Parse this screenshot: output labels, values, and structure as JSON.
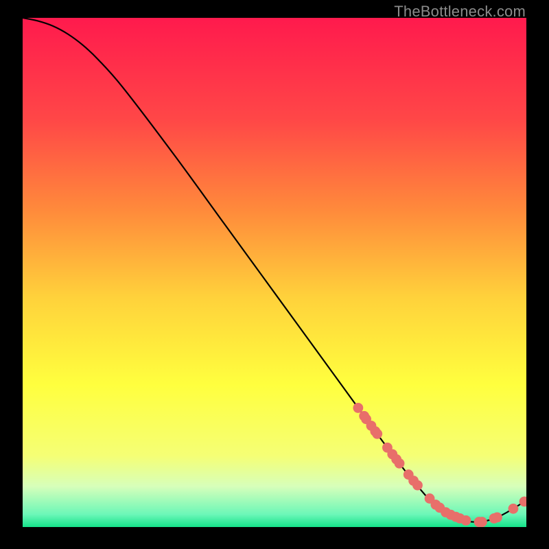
{
  "attribution": "TheBottleneck.com",
  "colors": {
    "black": "#000000",
    "curve": "#000000",
    "marker_fill": "#e86f6a",
    "marker_stroke": "#c64c47"
  },
  "chart_data": {
    "type": "line",
    "title": "",
    "xlabel": "",
    "ylabel": "",
    "xlim": [
      0,
      100
    ],
    "ylim": [
      0,
      100
    ],
    "grid": false,
    "legend": false,
    "background_gradient": {
      "stops": [
        {
          "pos": 0.0,
          "color": "#ff1a4d"
        },
        {
          "pos": 0.2,
          "color": "#ff4747"
        },
        {
          "pos": 0.38,
          "color": "#ff8b3b"
        },
        {
          "pos": 0.55,
          "color": "#ffd23b"
        },
        {
          "pos": 0.72,
          "color": "#ffff3e"
        },
        {
          "pos": 0.86,
          "color": "#f5ff75"
        },
        {
          "pos": 0.92,
          "color": "#d7ffba"
        },
        {
          "pos": 0.975,
          "color": "#6cf7b8"
        },
        {
          "pos": 1.0,
          "color": "#15e38a"
        }
      ]
    },
    "series": [
      {
        "name": "bottleneck-curve",
        "x": [
          0,
          3,
          6,
          9,
          12,
          15,
          20,
          30,
          40,
          50,
          60,
          70,
          75,
          80,
          82,
          85,
          88,
          90,
          92,
          94,
          96,
          98,
          100
        ],
        "y": [
          100,
          99.4,
          98.4,
          96.8,
          94.6,
          91.8,
          86.2,
          73.2,
          59.6,
          46.0,
          32.4,
          18.8,
          12.2,
          6.2,
          4.4,
          2.4,
          1.2,
          1.0,
          1.2,
          1.8,
          2.8,
          4.0,
          5.2
        ]
      }
    ],
    "markers": {
      "name": "highlighted-points",
      "x": [
        66.6,
        67.8,
        68.2,
        69.2,
        70.0,
        70.4,
        72.4,
        73.4,
        74.2,
        74.8,
        76.6,
        77.6,
        78.4,
        80.8,
        82.0,
        82.8,
        84.0,
        85.0,
        86.0,
        86.8,
        88.0,
        90.6,
        91.2,
        93.6,
        94.2,
        97.4,
        99.6
      ],
      "y": [
        23.4,
        21.8,
        21.2,
        19.9,
        18.8,
        18.3,
        15.6,
        14.3,
        13.3,
        12.5,
        10.3,
        9.1,
        8.2,
        5.6,
        4.4,
        3.8,
        2.9,
        2.4,
        2.0,
        1.7,
        1.3,
        1.0,
        1.0,
        1.7,
        1.9,
        3.6,
        5.0
      ]
    }
  }
}
